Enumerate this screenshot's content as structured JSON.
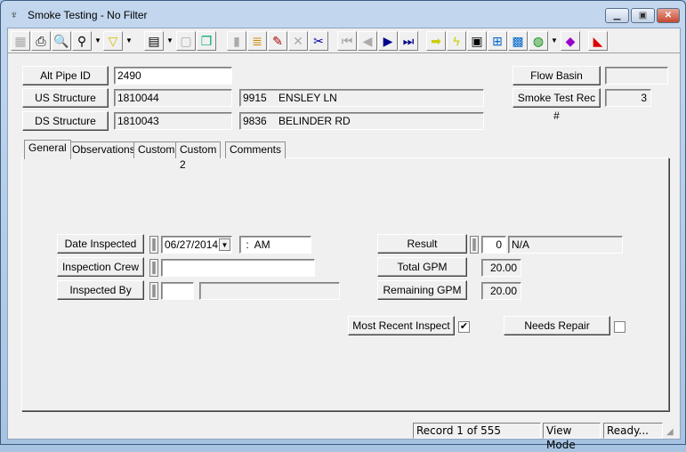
{
  "window": {
    "title": "Smoke Testing - No Filter",
    "app_icon": "smoke-tester-icon",
    "controls": [
      "minimize",
      "maximize",
      "close"
    ]
  },
  "toolbar": {
    "icons": [
      "grid-icon",
      "print-icon",
      "print-preview-icon",
      "find-icon",
      "filter-icon",
      "report-icon",
      "properties-icon",
      "copy-icon",
      "save-icon",
      "stack-icon",
      "edit-pencil-icon",
      "delete-icon",
      "cut-icon",
      "first-record-icon",
      "prev-record-icon",
      "next-record-icon",
      "last-record-icon",
      "goto-arrow-icon",
      "lightning-icon",
      "layout-icon",
      "flowchart-icon",
      "map-window-icon",
      "globe-icon",
      "book-icon",
      "export-icon"
    ]
  },
  "header": {
    "alt_pipe_id": {
      "label": "Alt Pipe ID",
      "value": "2490"
    },
    "us_structure": {
      "label": "US Structure",
      "value": "1810044",
      "address": "9915    ENSLEY LN"
    },
    "ds_structure": {
      "label": "DS Structure",
      "value": "1810043",
      "address": "9836    BELINDER RD"
    },
    "flow_basin": {
      "label": "Flow Basin",
      "value": ""
    },
    "smoke_test_rec": {
      "label": "Smoke Test Rec #",
      "value": "3"
    }
  },
  "tabs": [
    {
      "label": "General",
      "active": true
    },
    {
      "label": "Observations"
    },
    {
      "label": "Custom"
    },
    {
      "label": "Custom 2"
    },
    {
      "label": "Comments"
    }
  ],
  "general": {
    "date_inspected": {
      "label": "Date Inspected",
      "date": "06/27/2014",
      "time": " :  AM"
    },
    "inspection_crew": {
      "label": "Inspection Crew",
      "value": ""
    },
    "inspected_by": {
      "label": "Inspected By",
      "code": "",
      "name": ""
    },
    "result": {
      "label": "Result",
      "code": "0",
      "text": "N/A"
    },
    "total_gpm": {
      "label": "Total GPM",
      "value": "20.00"
    },
    "remaining_gpm": {
      "label": "Remaining GPM",
      "value": "20.00"
    },
    "most_recent_inspect": {
      "label": "Most Recent Inspect",
      "checked": true
    },
    "needs_repair": {
      "label": "Needs Repair",
      "checked": false
    }
  },
  "status": {
    "record": "Record 1 of 555",
    "mode": "View Mode",
    "state": "Ready..."
  }
}
